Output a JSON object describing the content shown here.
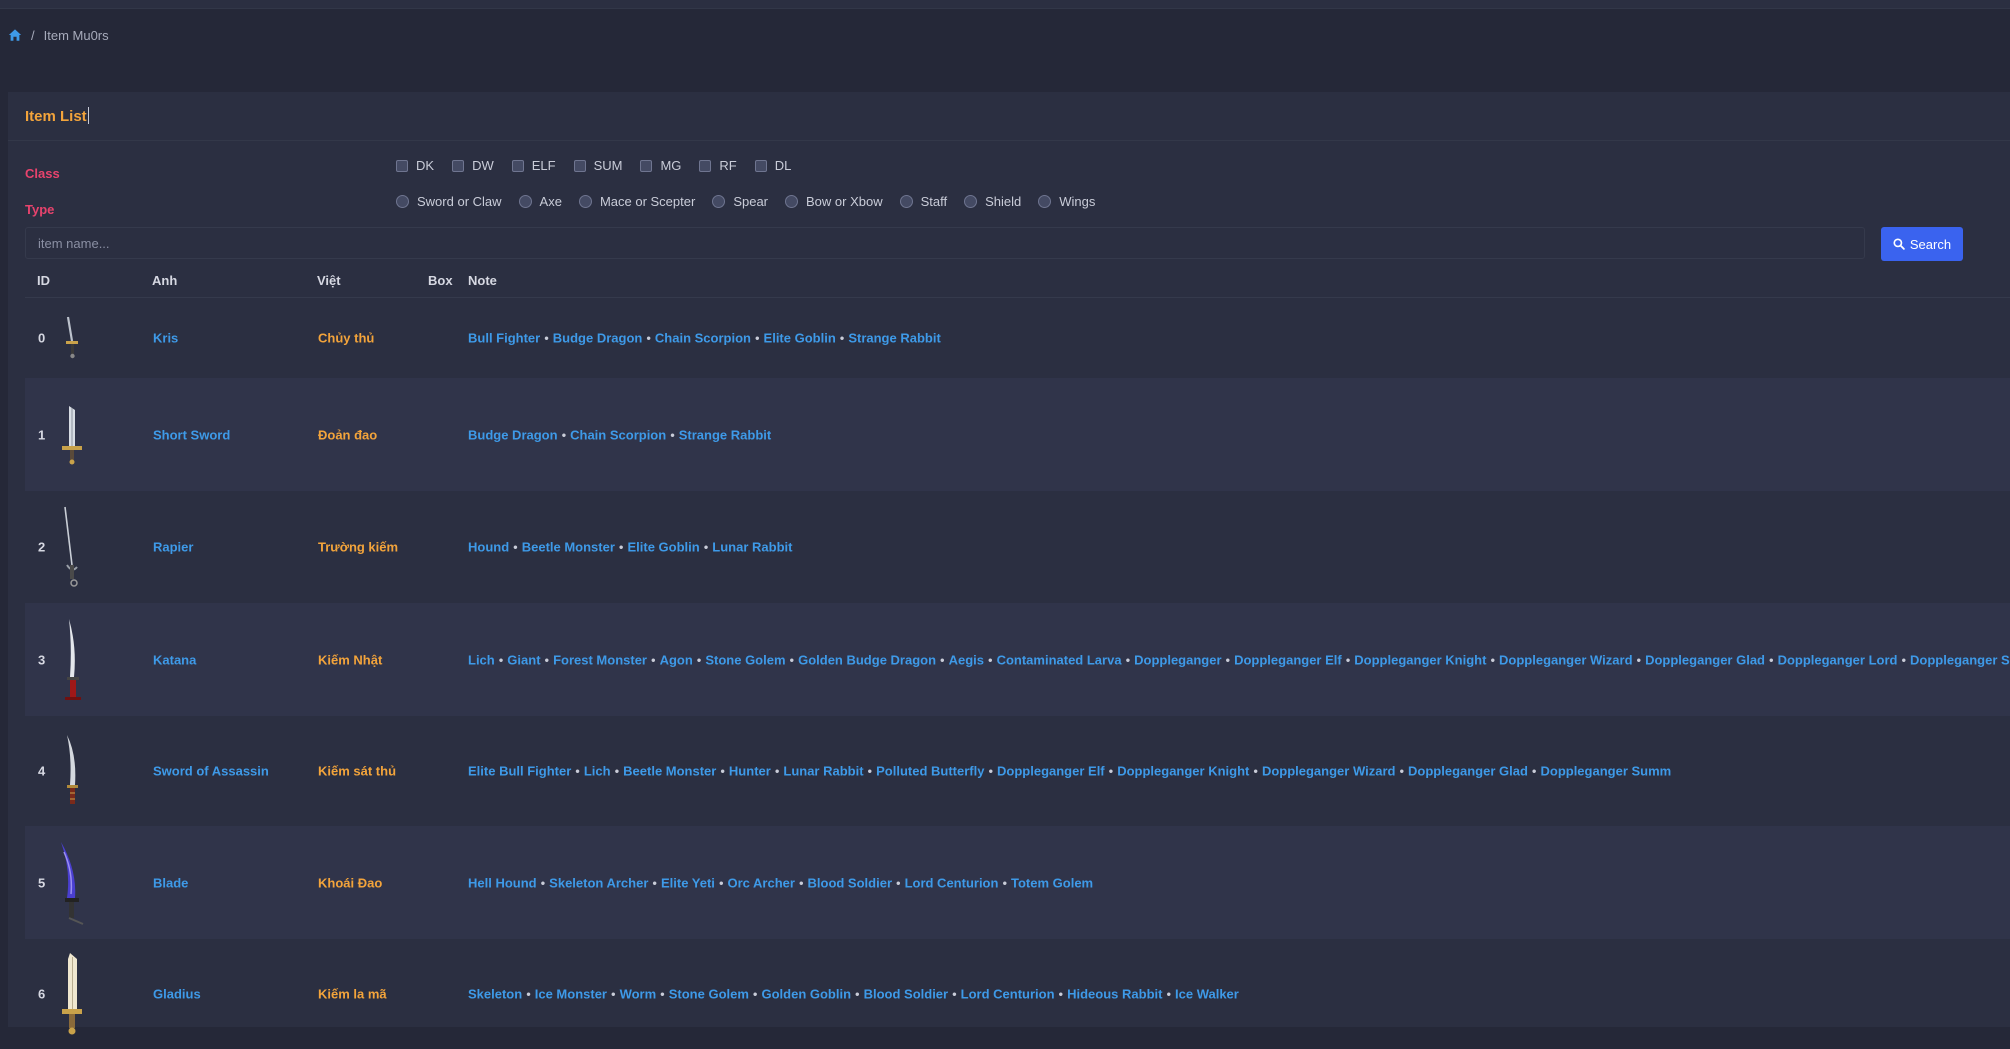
{
  "breadcrumb": {
    "home_icon": "home-icon",
    "current": "Item Mu0rs"
  },
  "card": {
    "title": "Item List"
  },
  "filters": {
    "class_label": "Class",
    "type_label": "Type",
    "classes": [
      "DK",
      "DW",
      "ELF",
      "SUM",
      "MG",
      "RF",
      "DL"
    ],
    "types": [
      "Sword or Claw",
      "Axe",
      "Mace or Scepter",
      "Spear",
      "Bow or Xbow",
      "Staff",
      "Shield",
      "Wings"
    ]
  },
  "search": {
    "placeholder": "item name...",
    "button_label": "Search"
  },
  "table": {
    "headers": {
      "id": "ID",
      "image": "Anh",
      "viet": "Việt",
      "box": "Box",
      "note": "Note"
    },
    "rows": [
      {
        "id": "0",
        "name": "Kris",
        "viet": "Chủy thủ",
        "mobs": [
          "Bull Fighter",
          "Budge Dragon",
          "Chain Scorpion",
          "Elite Goblin",
          "Strange Rabbit"
        ]
      },
      {
        "id": "1",
        "name": "Short Sword",
        "viet": "Đoản đao",
        "mobs": [
          "Budge Dragon",
          "Chain Scorpion",
          "Strange Rabbit"
        ]
      },
      {
        "id": "2",
        "name": "Rapier",
        "viet": "Trường kiếm",
        "mobs": [
          "Hound",
          "Beetle Monster",
          "Elite Goblin",
          "Lunar Rabbit"
        ]
      },
      {
        "id": "3",
        "name": "Katana",
        "viet": "Kiếm Nhật",
        "mobs": [
          "Lich",
          "Giant",
          "Forest Monster",
          "Agon",
          "Stone Golem",
          "Golden Budge Dragon",
          "Aegis",
          "Contaminated Larva",
          "Doppleganger",
          "Doppleganger Elf",
          "Doppleganger Knight",
          "Doppleganger Wizard",
          "Doppleganger Glad",
          "Doppleganger Lord",
          "Doppleganger Summ"
        ]
      },
      {
        "id": "4",
        "name": "Sword of Assassin",
        "viet": "Kiếm sát thủ",
        "mobs": [
          "Elite Bull Fighter",
          "Lich",
          "Beetle Monster",
          "Hunter",
          "Lunar Rabbit",
          "Polluted Butterfly",
          "Doppleganger Elf",
          "Doppleganger Knight",
          "Doppleganger Wizard",
          "Doppleganger Glad",
          "Doppleganger Summ"
        ]
      },
      {
        "id": "5",
        "name": "Blade",
        "viet": "Khoái Đao",
        "mobs": [
          "Hell Hound",
          "Skeleton Archer",
          "Elite Yeti",
          "Orc Archer",
          "Blood Soldier",
          "Lord Centurion",
          "Totem Golem"
        ]
      },
      {
        "id": "6",
        "name": "Gladius",
        "viet": "Kiếm la mã",
        "mobs": [
          "Skeleton",
          "Ice Monster",
          "Worm",
          "Stone Golem",
          "Golden Goblin",
          "Blood Soldier",
          "Lord Centurion",
          "Hideous Rabbit",
          "Ice Walker"
        ]
      }
    ]
  }
}
